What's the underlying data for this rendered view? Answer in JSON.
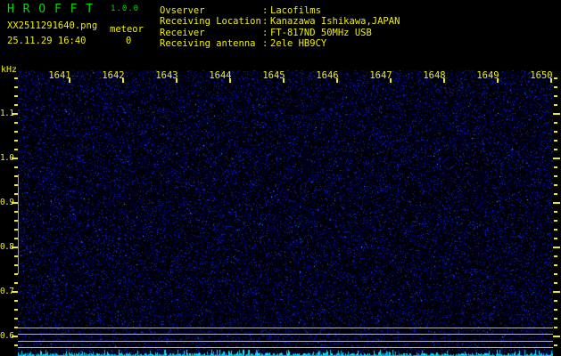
{
  "app": {
    "title": "H R O F F T",
    "version": "1.0.0"
  },
  "session": {
    "filename": "XX2511291640.png",
    "mode_label": "meteor",
    "meteor_count": "0",
    "datetime": "25.11.29 16:40"
  },
  "station": {
    "separator": ":",
    "rows": [
      {
        "label": "Ovserver",
        "value": "Lacofilms"
      },
      {
        "label": "Receiving Location",
        "value": "Kanazawa Ishikawa,JAPAN"
      },
      {
        "label": "Receiver",
        "value": "FT-817ND 50MHz USB"
      },
      {
        "label": "Receiving antenna",
        "value": "2ele HB9CY"
      }
    ]
  },
  "chart": {
    "type": "spectrogram",
    "ylabel": "kHz",
    "freq_ticks": [
      "1.1",
      "1.0",
      "0.9",
      "0.8",
      "0.7",
      "0.6"
    ],
    "time_ticks": [
      "1641",
      "1642",
      "1643",
      "1644",
      "1645",
      "1646",
      "1647",
      "1648",
      "1649",
      "1650"
    ],
    "colors": {
      "text_yellow": "#f0f000",
      "text_green": "#00dd00",
      "background": "#000000",
      "noise_blue": "#0000cc",
      "signal_cyan": "#00d8ff",
      "grid_gray": "#b4b4b4"
    }
  }
}
